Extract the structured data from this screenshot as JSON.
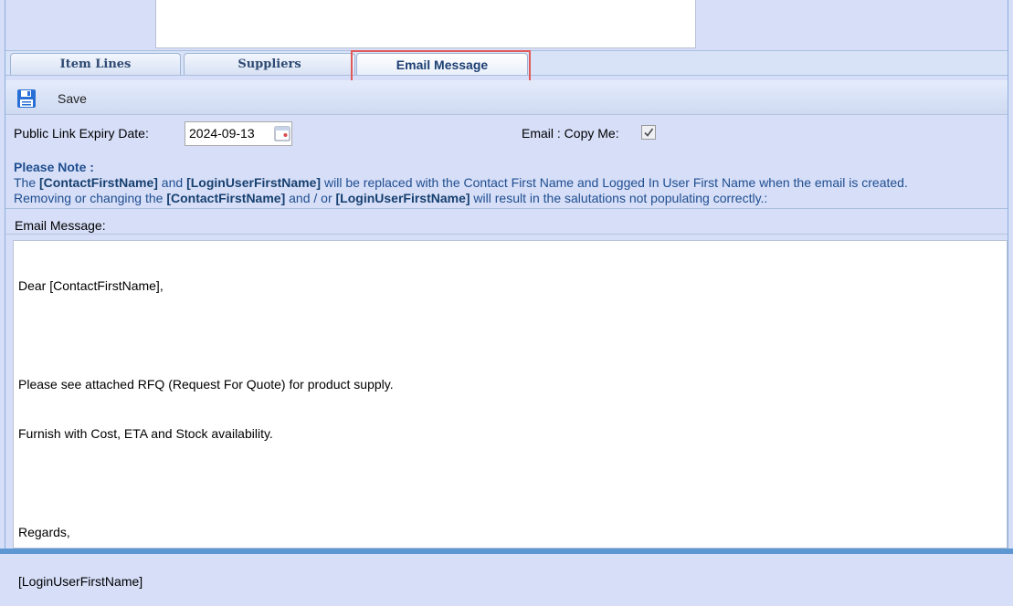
{
  "tabs": [
    {
      "label": "Item Lines",
      "active": false
    },
    {
      "label": "Suppliers",
      "active": false
    },
    {
      "label": "Email Message",
      "active": true
    }
  ],
  "toolbar": {
    "save_label": "Save",
    "save_icon": "floppy-disk-icon"
  },
  "form": {
    "expiry_label": "Public Link Expiry Date:",
    "expiry_value": "2024-09-13",
    "calendar_icon": "calendar-icon",
    "copy_me_label": "Email : Copy Me:",
    "copy_me_checked": true
  },
  "note": {
    "heading": "Please Note :",
    "line1_a": "The ",
    "line1_b": "[ContactFirstName]",
    "line1_c": " and ",
    "line1_d": "[LoginUserFirstName]",
    "line1_e": " will be replaced with the Contact First Name and Logged In User First Name when the email is created.",
    "line2_a": "Removing or changing the ",
    "line2_b": "[ContactFirstName]",
    "line2_c": " and / or ",
    "line2_d": "[LoginUserFirstName]",
    "line2_e": " will result in the salutations not populating correctly.:"
  },
  "email": {
    "label": "Email Message:",
    "lines": [
      "Dear [ContactFirstName],",
      "",
      "Please see attached RFQ (Request For Quote) for product supply.",
      "Furnish with Cost, ETA and Stock availability.",
      "",
      "Regards,",
      "[LoginUserFirstName]"
    ]
  },
  "colors": {
    "background": "#d6def8",
    "note_text": "#1f4e8f",
    "highlight_border": "#e05a5a",
    "accent_blue": "#2a6fd6"
  }
}
